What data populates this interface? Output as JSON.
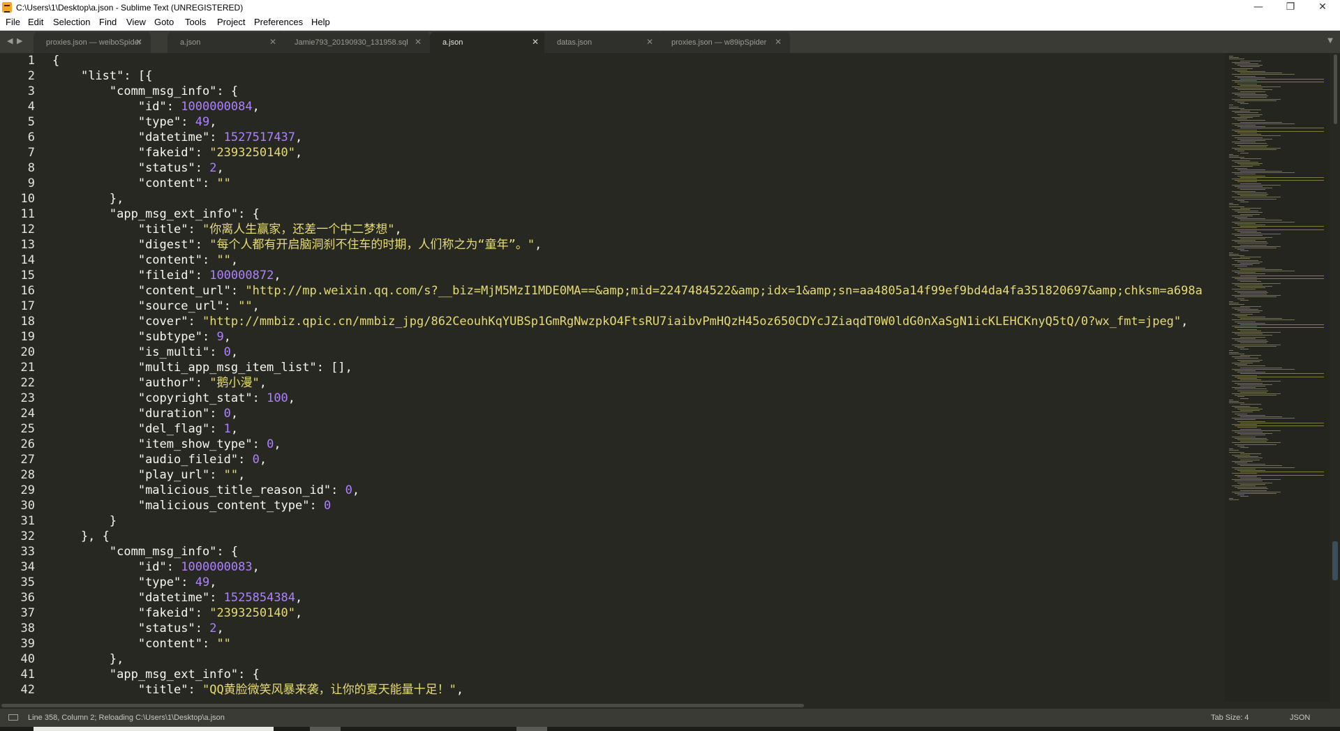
{
  "window": {
    "title": "C:\\Users\\1\\Desktop\\a.json - Sublime Text (UNREGISTERED)",
    "controls": {
      "minimize": "—",
      "maximize": "❐",
      "close": "✕"
    }
  },
  "menu": [
    "File",
    "Edit",
    "Selection",
    "Find",
    "View",
    "Goto",
    "Tools",
    "Project",
    "Preferences",
    "Help"
  ],
  "tabs": [
    {
      "label": "proxies.json — weiboSpider",
      "active": false
    },
    {
      "label": "a.json",
      "active": false
    },
    {
      "label": "Jamie793_20190930_131958.sql",
      "active": false
    },
    {
      "label": "a.json",
      "active": true
    },
    {
      "label": "datas.json",
      "active": false
    },
    {
      "label": "proxies.json — w89ipSpider",
      "active": false
    }
  ],
  "tab_close_glyph": "✕",
  "tab_nav": {
    "prev": "◀",
    "next": "▶",
    "menu": "▼"
  },
  "editor": {
    "line_numbers": [
      "1",
      "2",
      "3",
      "4",
      "5",
      "6",
      "7",
      "8",
      "9",
      "10",
      "11",
      "12",
      "13",
      "14",
      "15",
      "16",
      "17",
      "18",
      "19",
      "20",
      "21",
      "22",
      "23",
      "24",
      "25",
      "26",
      "27",
      "28",
      "29",
      "30",
      "31",
      "32",
      "33",
      "34",
      "35",
      "36",
      "37",
      "38",
      "39",
      "40",
      "41",
      "42"
    ],
    "lines": [
      [
        [
          "p",
          "{"
        ]
      ],
      [
        [
          "p",
          "    "
        ],
        [
          "k",
          "\"list\""
        ],
        [
          "p",
          ": [{"
        ]
      ],
      [
        [
          "p",
          "        "
        ],
        [
          "k",
          "\"comm_msg_info\""
        ],
        [
          "p",
          ": {"
        ]
      ],
      [
        [
          "p",
          "            "
        ],
        [
          "k",
          "\"id\""
        ],
        [
          "p",
          ": "
        ],
        [
          "n",
          "1000000084"
        ],
        [
          "p",
          ","
        ]
      ],
      [
        [
          "p",
          "            "
        ],
        [
          "k",
          "\"type\""
        ],
        [
          "p",
          ": "
        ],
        [
          "n",
          "49"
        ],
        [
          "p",
          ","
        ]
      ],
      [
        [
          "p",
          "            "
        ],
        [
          "k",
          "\"datetime\""
        ],
        [
          "p",
          ": "
        ],
        [
          "n",
          "1527517437"
        ],
        [
          "p",
          ","
        ]
      ],
      [
        [
          "p",
          "            "
        ],
        [
          "k",
          "\"fakeid\""
        ],
        [
          "p",
          ": "
        ],
        [
          "s",
          "\"2393250140\""
        ],
        [
          "p",
          ","
        ]
      ],
      [
        [
          "p",
          "            "
        ],
        [
          "k",
          "\"status\""
        ],
        [
          "p",
          ": "
        ],
        [
          "n",
          "2"
        ],
        [
          "p",
          ","
        ]
      ],
      [
        [
          "p",
          "            "
        ],
        [
          "k",
          "\"content\""
        ],
        [
          "p",
          ": "
        ],
        [
          "s",
          "\"\""
        ]
      ],
      [
        [
          "p",
          "        },"
        ]
      ],
      [
        [
          "p",
          "        "
        ],
        [
          "k",
          "\"app_msg_ext_info\""
        ],
        [
          "p",
          ": {"
        ]
      ],
      [
        [
          "p",
          "            "
        ],
        [
          "k",
          "\"title\""
        ],
        [
          "p",
          ": "
        ],
        [
          "s",
          "\"你离人生赢家，还差一个中二梦想\""
        ],
        [
          "p",
          ","
        ]
      ],
      [
        [
          "p",
          "            "
        ],
        [
          "k",
          "\"digest\""
        ],
        [
          "p",
          ": "
        ],
        [
          "s",
          "\"每个人都有开启脑洞刹不住车的时期，人们称之为“童年”。\""
        ],
        [
          "p",
          ","
        ]
      ],
      [
        [
          "p",
          "            "
        ],
        [
          "k",
          "\"content\""
        ],
        [
          "p",
          ": "
        ],
        [
          "s",
          "\"\""
        ],
        [
          "p",
          ","
        ]
      ],
      [
        [
          "p",
          "            "
        ],
        [
          "k",
          "\"fileid\""
        ],
        [
          "p",
          ": "
        ],
        [
          "n",
          "100000872"
        ],
        [
          "p",
          ","
        ]
      ],
      [
        [
          "p",
          "            "
        ],
        [
          "k",
          "\"content_url\""
        ],
        [
          "p",
          ": "
        ],
        [
          "s",
          "\"http://mp.weixin.qq.com/s?__biz=MjM5MzI1MDE0MA==&amp;mid=2247484522&amp;idx=1&amp;sn=aa4805a14f99ef9bd4da4fa351820697&amp;chksm=a698a"
        ]
      ],
      [
        [
          "p",
          "            "
        ],
        [
          "k",
          "\"source_url\""
        ],
        [
          "p",
          ": "
        ],
        [
          "s",
          "\"\""
        ],
        [
          "p",
          ","
        ]
      ],
      [
        [
          "p",
          "            "
        ],
        [
          "k",
          "\"cover\""
        ],
        [
          "p",
          ": "
        ],
        [
          "s",
          "\"http://mmbiz.qpic.cn/mmbiz_jpg/862CeouhKqYUBSp1GmRgNwzpkO4FtsRU7iaibvPmHQzH45oz650CDYcJZiaqdT0W0ldG0nXaSgN1icKLEHCKnyQ5tQ/0?wx_fmt=jpeg\""
        ],
        [
          "p",
          ","
        ]
      ],
      [
        [
          "p",
          "            "
        ],
        [
          "k",
          "\"subtype\""
        ],
        [
          "p",
          ": "
        ],
        [
          "n",
          "9"
        ],
        [
          "p",
          ","
        ]
      ],
      [
        [
          "p",
          "            "
        ],
        [
          "k",
          "\"is_multi\""
        ],
        [
          "p",
          ": "
        ],
        [
          "n",
          "0"
        ],
        [
          "p",
          ","
        ]
      ],
      [
        [
          "p",
          "            "
        ],
        [
          "k",
          "\"multi_app_msg_item_list\""
        ],
        [
          "p",
          ": [],"
        ]
      ],
      [
        [
          "p",
          "            "
        ],
        [
          "k",
          "\"author\""
        ],
        [
          "p",
          ": "
        ],
        [
          "s",
          "\"鹅小漫\""
        ],
        [
          "p",
          ","
        ]
      ],
      [
        [
          "p",
          "            "
        ],
        [
          "k",
          "\"copyright_stat\""
        ],
        [
          "p",
          ": "
        ],
        [
          "n",
          "100"
        ],
        [
          "p",
          ","
        ]
      ],
      [
        [
          "p",
          "            "
        ],
        [
          "k",
          "\"duration\""
        ],
        [
          "p",
          ": "
        ],
        [
          "n",
          "0"
        ],
        [
          "p",
          ","
        ]
      ],
      [
        [
          "p",
          "            "
        ],
        [
          "k",
          "\"del_flag\""
        ],
        [
          "p",
          ": "
        ],
        [
          "n",
          "1"
        ],
        [
          "p",
          ","
        ]
      ],
      [
        [
          "p",
          "            "
        ],
        [
          "k",
          "\"item_show_type\""
        ],
        [
          "p",
          ": "
        ],
        [
          "n",
          "0"
        ],
        [
          "p",
          ","
        ]
      ],
      [
        [
          "p",
          "            "
        ],
        [
          "k",
          "\"audio_fileid\""
        ],
        [
          "p",
          ": "
        ],
        [
          "n",
          "0"
        ],
        [
          "p",
          ","
        ]
      ],
      [
        [
          "p",
          "            "
        ],
        [
          "k",
          "\"play_url\""
        ],
        [
          "p",
          ": "
        ],
        [
          "s",
          "\"\""
        ],
        [
          "p",
          ","
        ]
      ],
      [
        [
          "p",
          "            "
        ],
        [
          "k",
          "\"malicious_title_reason_id\""
        ],
        [
          "p",
          ": "
        ],
        [
          "n",
          "0"
        ],
        [
          "p",
          ","
        ]
      ],
      [
        [
          "p",
          "            "
        ],
        [
          "k",
          "\"malicious_content_type\""
        ],
        [
          "p",
          ": "
        ],
        [
          "n",
          "0"
        ]
      ],
      [
        [
          "p",
          "        }"
        ]
      ],
      [
        [
          "p",
          "    }, {"
        ]
      ],
      [
        [
          "p",
          "        "
        ],
        [
          "k",
          "\"comm_msg_info\""
        ],
        [
          "p",
          ": {"
        ]
      ],
      [
        [
          "p",
          "            "
        ],
        [
          "k",
          "\"id\""
        ],
        [
          "p",
          ": "
        ],
        [
          "n",
          "1000000083"
        ],
        [
          "p",
          ","
        ]
      ],
      [
        [
          "p",
          "            "
        ],
        [
          "k",
          "\"type\""
        ],
        [
          "p",
          ": "
        ],
        [
          "n",
          "49"
        ],
        [
          "p",
          ","
        ]
      ],
      [
        [
          "p",
          "            "
        ],
        [
          "k",
          "\"datetime\""
        ],
        [
          "p",
          ": "
        ],
        [
          "n",
          "1525854384"
        ],
        [
          "p",
          ","
        ]
      ],
      [
        [
          "p",
          "            "
        ],
        [
          "k",
          "\"fakeid\""
        ],
        [
          "p",
          ": "
        ],
        [
          "s",
          "\"2393250140\""
        ],
        [
          "p",
          ","
        ]
      ],
      [
        [
          "p",
          "            "
        ],
        [
          "k",
          "\"status\""
        ],
        [
          "p",
          ": "
        ],
        [
          "n",
          "2"
        ],
        [
          "p",
          ","
        ]
      ],
      [
        [
          "p",
          "            "
        ],
        [
          "k",
          "\"content\""
        ],
        [
          "p",
          ": "
        ],
        [
          "s",
          "\"\""
        ]
      ],
      [
        [
          "p",
          "        },"
        ]
      ],
      [
        [
          "p",
          "        "
        ],
        [
          "k",
          "\"app_msg_ext_info\""
        ],
        [
          "p",
          ": {"
        ]
      ],
      [
        [
          "p",
          "            "
        ],
        [
          "k",
          "\"title\""
        ],
        [
          "p",
          ": "
        ],
        [
          "s",
          "\"QQ黄脸微笑风暴来袭，让你的夏天能量十足！\""
        ],
        [
          "p",
          ","
        ]
      ]
    ]
  },
  "colors": {
    "background": "#272822",
    "key": "#f8f8f2",
    "string": "#e6db74",
    "number": "#ae81ff"
  },
  "status": {
    "message": "Line 358, Column 2; Reloading C:\\Users\\1\\Desktop\\a.json",
    "tab_size": "Tab Size: 4",
    "syntax": "JSON"
  }
}
